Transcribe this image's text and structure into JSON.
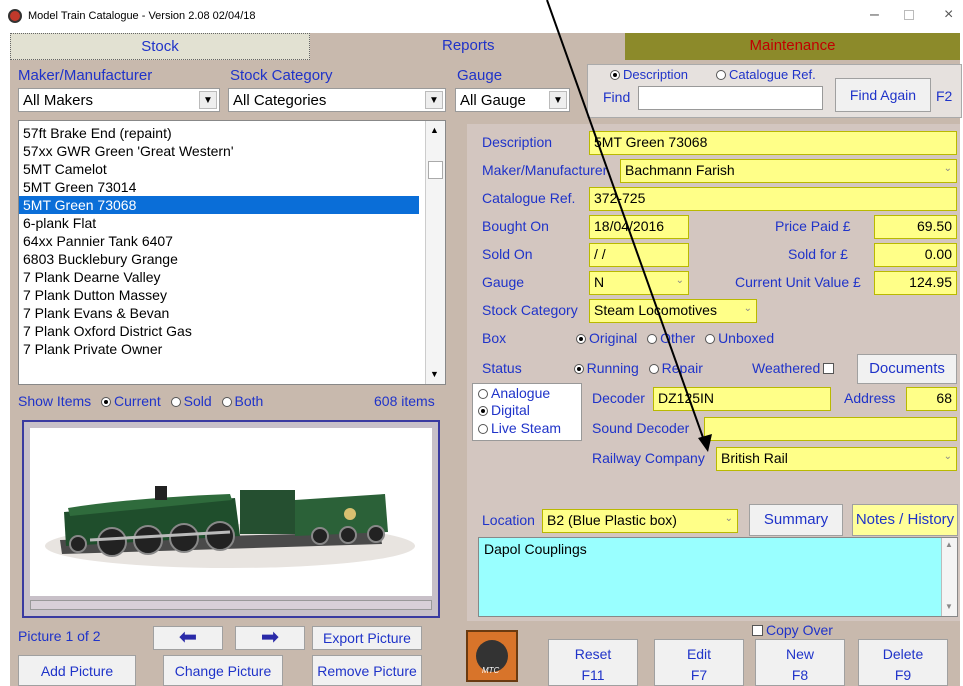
{
  "window": {
    "title": "Model Train Catalogue - Version 2.08 02/04/18"
  },
  "tabs": [
    "Stock",
    "Reports",
    "Maintenance"
  ],
  "filters": {
    "maker_label": "Maker/Manufacturer",
    "maker_value": "All Makers",
    "category_label": "Stock Category",
    "category_value": "All Categories",
    "gauge_label": "Gauge",
    "gauge_value": "All Gauge"
  },
  "find": {
    "description_option": "Description",
    "catalogue_option": "Catalogue Ref.",
    "label": "Find",
    "value": "",
    "button": "Find Again",
    "shortcut": "F2"
  },
  "stock_list": [
    "57ft Brake End (repaint)",
    "57xx GWR Green 'Great Western'",
    "5MT Camelot",
    "5MT Green 73014",
    "5MT Green 73068",
    "6-plank Flat",
    "64xx Pannier Tank 6407",
    "6803 Bucklebury Grange",
    "7 Plank Dearne Valley",
    "7 Plank Dutton Massey",
    "7 Plank Evans & Bevan",
    "7 Plank Oxford District Gas",
    "7 Plank Private Owner"
  ],
  "show_items": {
    "label": "Show Items",
    "options": [
      "Current",
      "Sold",
      "Both"
    ],
    "selected": "Current",
    "count": "608 items"
  },
  "picture": {
    "counter": "Picture 1 of 2",
    "export": "Export Picture",
    "add": "Add Picture",
    "change": "Change Picture",
    "remove": "Remove Picture"
  },
  "details": {
    "description_label": "Description",
    "description": "5MT Green 73068",
    "maker_label": "Maker/Manufacturer",
    "maker": "Bachmann Farish",
    "catref_label": "Catalogue Ref.",
    "catref": "372-725",
    "bought_label": "Bought On",
    "bought": "18/04/2016",
    "price_label": "Price Paid £",
    "price": "69.50",
    "sold_label": "Sold On",
    "sold": "/ /",
    "soldfor_label": "Sold for £",
    "soldfor": "0.00",
    "gauge_label": "Gauge",
    "gauge": "N",
    "cuv_label": "Current Unit Value £",
    "cuv": "124.95",
    "category_label": "Stock Category",
    "category": "Steam Locomotives",
    "box_label": "Box",
    "box_options": [
      "Original",
      "Other",
      "Unboxed"
    ],
    "status_label": "Status",
    "status_options": [
      "Running",
      "Repair"
    ],
    "weathered_label": "Weathered",
    "documents": "Documents",
    "control_options": [
      "Analogue",
      "Digital",
      "Live Steam"
    ],
    "decoder_label": "Decoder",
    "decoder": "DZ125IN",
    "address_label": "Address",
    "address": "68",
    "sound_label": "Sound Decoder",
    "sound": "",
    "railway_label": "Railway Company",
    "railway": "British Rail",
    "location_label": "Location",
    "location": "B2 (Blue Plastic box)",
    "summary": "Summary",
    "notes": "Notes / History",
    "notes_text": "Dapol Couplings"
  },
  "actions": {
    "copy_over": "Copy Over",
    "reset": "Reset",
    "reset_key": "F11",
    "edit": "Edit",
    "edit_key": "F7",
    "new": "New",
    "new_key": "F8",
    "delete": "Delete",
    "delete_key": "F9",
    "logo": "MTC"
  },
  "colors": {
    "tab_stock": "#e2e1d2",
    "tab_reports": "#c8b9ad",
    "tab_maint": "#8c8a2a",
    "panel": "#c8b9ad",
    "field": "#ffff88",
    "notes": "#99ffff",
    "selection": "#0a6ed8"
  }
}
